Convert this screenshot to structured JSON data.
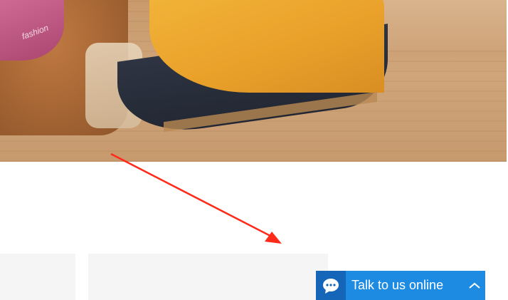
{
  "chat_widget": {
    "label": "Talk to us online",
    "icon": "chat-bubble-icon",
    "toggle_icon": "chevron-up-icon",
    "color": "#1e8be3",
    "icon_bg": "#1565b8"
  },
  "banner": {
    "logo_text": "fashion"
  },
  "annotation": {
    "arrow_color": "#ff2a1a"
  }
}
